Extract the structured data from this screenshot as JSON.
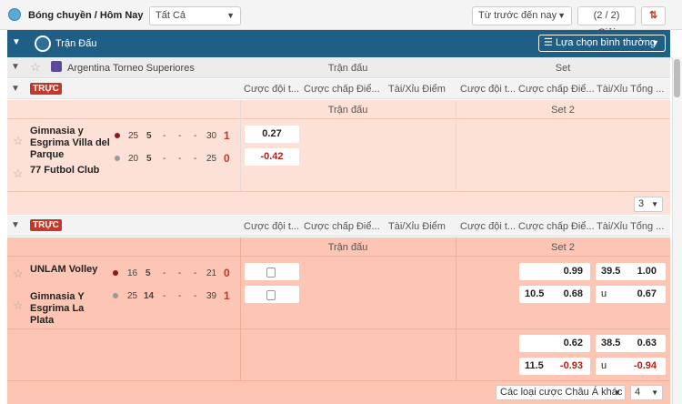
{
  "topbar": {
    "breadcrumb": "Bóng chuyền / Hôm Nay",
    "filter_value": "Tất Cả",
    "time_value": "Từ trước đến nay",
    "count": "(2 / 2) Giải"
  },
  "band": {
    "title": "Trận Đấu",
    "mode_button": "Lựa chọn bình thường"
  },
  "league": {
    "name": "Argentina Torneo Superiores",
    "col_match": "Trận đấu",
    "col_set": "Set"
  },
  "live_label": "TRỰC",
  "market_cols": {
    "m1": "Cược đội t...",
    "m2": "Cược chấp Điể...",
    "m3": "Tài/Xỉu Điểm",
    "s1": "Cược đội t...",
    "s2": "Cược chấp Điể...",
    "s3": "Tài/Xỉu Tổng ..."
  },
  "matches": [
    {
      "period_match": "Trận đấu",
      "period_set": "Set 2",
      "home": "Gimnasia y Esgrima Villa del Parque",
      "away": "77 Futbol Club",
      "home_scores": [
        "25",
        "5",
        "-",
        "-",
        "-",
        "30"
      ],
      "away_scores": [
        "20",
        "5",
        "-",
        "-",
        "-",
        "25"
      ],
      "home_sets": "1",
      "away_sets": "0",
      "home_odds": "0.27",
      "away_odds": "-0.42",
      "more_count": "3"
    },
    {
      "period_match": "Trận đấu",
      "period_set": "Set 2",
      "home": "UNLAM Volley",
      "away": "Gimnasia Y Esgrima La Plata",
      "home_scores": [
        "16",
        "5",
        "-",
        "-",
        "-",
        "21"
      ],
      "away_scores": [
        "25",
        "14",
        "-",
        "-",
        "-",
        "39"
      ],
      "home_sets": "0",
      "away_sets": "1",
      "row1": {
        "win_home": "0.99",
        "ou_line": "39.5",
        "ou_over": "1.00",
        "hc_line": "10.5",
        "hc_away": "0.68",
        "ou_u": "u",
        "ou_under": "0.67"
      },
      "row2": {
        "win_home": "0.62",
        "ou_line": "38.5",
        "ou_over": "0.63",
        "hc_line": "11.5",
        "hc_away": "-0.93",
        "ou_u": "u",
        "ou_under": "-0.94"
      },
      "bet_type": "Các loại cược Châu Á khác",
      "more_count": "4"
    }
  ],
  "colors": {
    "accent": "#1f5f86",
    "live": "#c0392b",
    "row_pink": "#fde0d6",
    "row_salmon": "#fcc5b4"
  }
}
